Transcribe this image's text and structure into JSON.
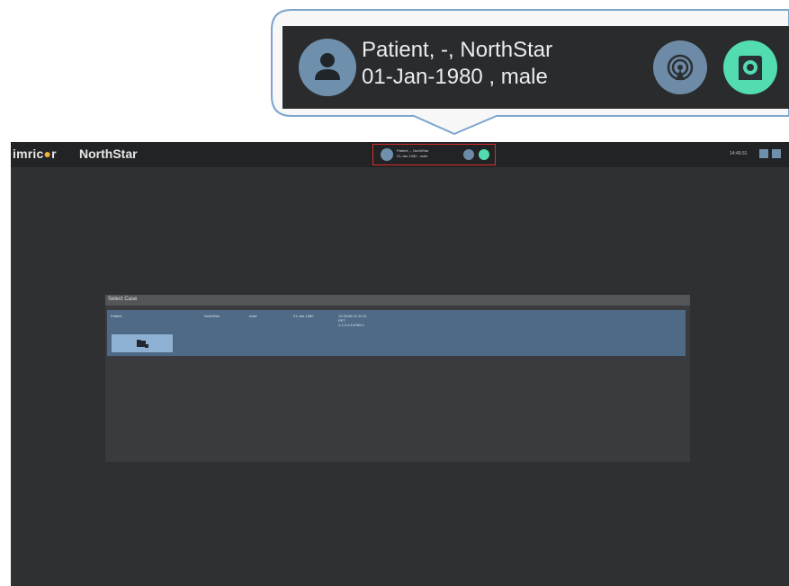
{
  "callout": {
    "name_line": "Patient, -, NorthStar",
    "dob_line": "01-Jan-1980 , male"
  },
  "topbar": {
    "logo_prefix": "imric",
    "logo_mark": "●",
    "logo_suffix": "r",
    "app_title": "NorthStar",
    "clock": "14:40:31"
  },
  "mini_patient": {
    "name_line": "Patient, -, NorthStar",
    "dob_line": "01-Jan-1980 , male"
  },
  "dialog": {
    "title": "Select Case",
    "row": {
      "name": "Patient",
      "patient_id": "NorthStar",
      "sex": "male",
      "dob": "01-Jan-1980",
      "study_line1": "12:34:56 11:11:11",
      "study_line2": "PET",
      "study_line3": "1.2.3.4.5.6789.1"
    }
  },
  "icons": {
    "avatar": "person-icon",
    "broadcast": "broadcast-icon",
    "scanner": "scanner-icon",
    "open_case": "folder-open-icon"
  },
  "colors": {
    "accent_blue": "#6f90ad",
    "accent_teal": "#52dcb0",
    "highlight_red": "#d92d2d",
    "row_bg": "#4e6a86",
    "button_bg": "#8eb1d3"
  }
}
